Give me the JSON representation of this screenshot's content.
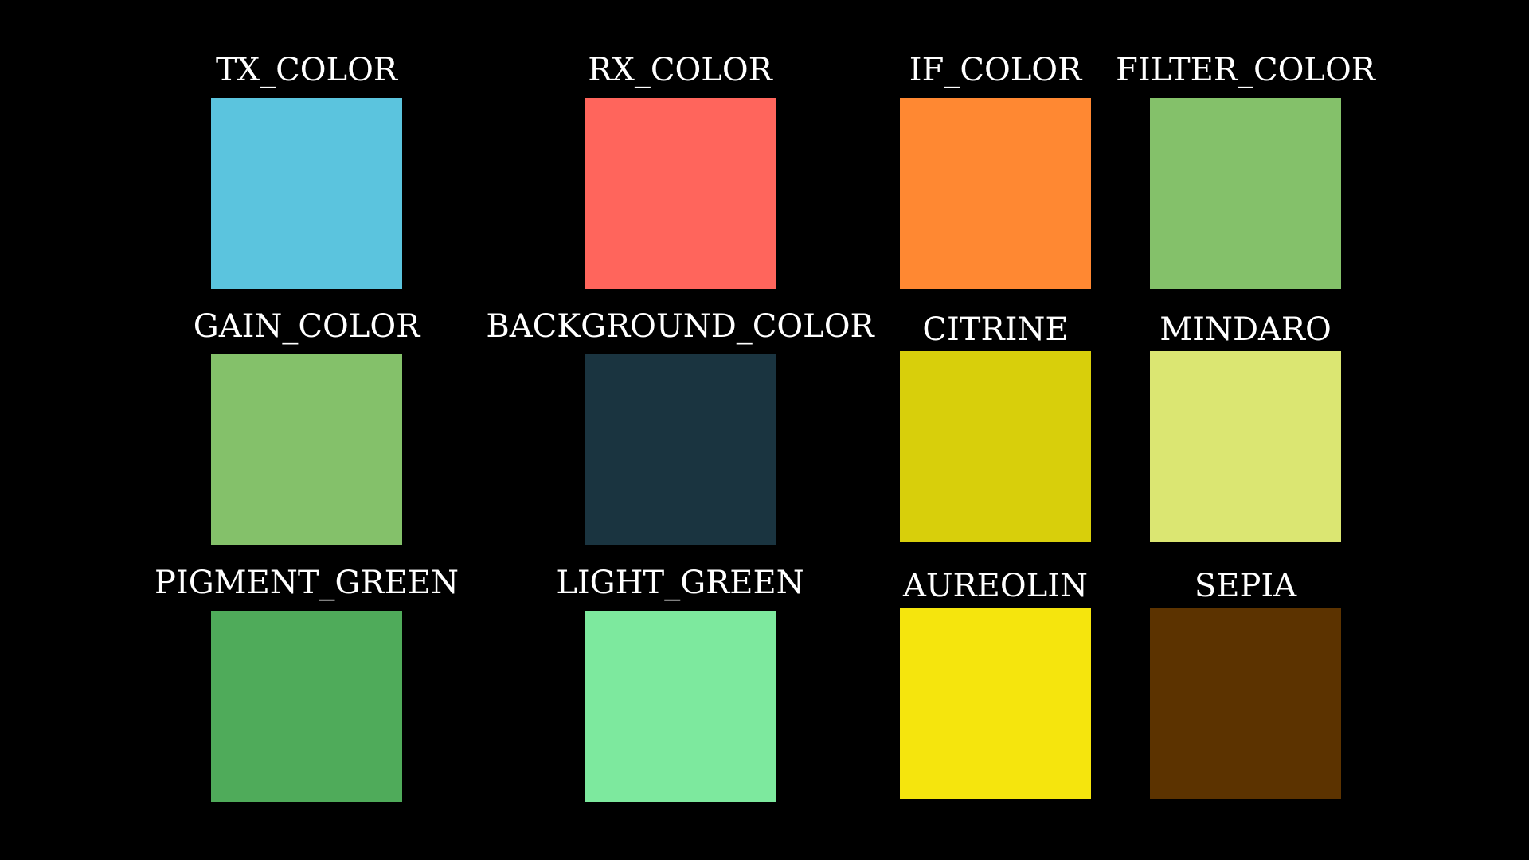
{
  "swatches": [
    {
      "label": "TX_COLOR",
      "color": "#5BC4DE"
    },
    {
      "label": "RX_COLOR",
      "color": "#FF655C"
    },
    {
      "label": "IF_COLOR",
      "color": "#FF8832"
    },
    {
      "label": "FILTER_COLOR",
      "color": "#84C16A"
    },
    {
      "label": "GAIN_COLOR",
      "color": "#84C16A"
    },
    {
      "label": "BACKGROUND_COLOR",
      "color": "#1A3440"
    },
    {
      "label": "CITRINE",
      "color": "#D8CF0B"
    },
    {
      "label": "MINDARO",
      "color": "#DBE672"
    },
    {
      "label": "PIGMENT_GREEN",
      "color": "#4FAB5A"
    },
    {
      "label": "LIGHT_GREEN",
      "color": "#7DE99E"
    },
    {
      "label": "AUREOLIN",
      "color": "#F5E50D"
    },
    {
      "label": "SEPIA",
      "color": "#5C3300"
    }
  ]
}
